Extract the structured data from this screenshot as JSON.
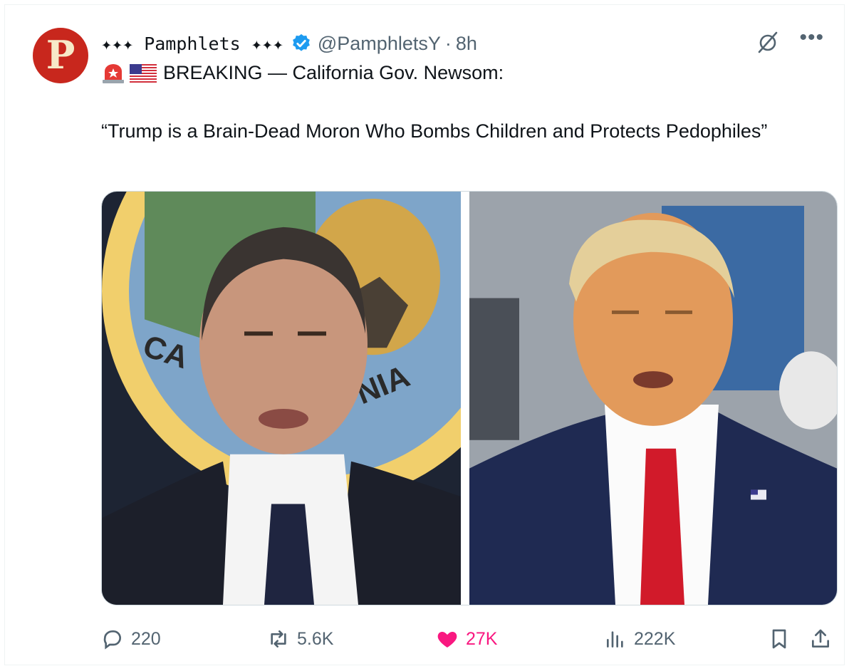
{
  "author": {
    "avatar_letter": "P",
    "display_name": "✦✦✦ Pamphlets ✦✦✦",
    "handle": "@PamphletsY",
    "separator": "·",
    "time": "8h"
  },
  "tweet": {
    "emoji_siren": "🚨",
    "emoji_flag": "🇺🇸",
    "headline": "BREAKING — California Gov. Newsom:",
    "quote": "“Trump is a Brain-Dead Moron Who Bombs Children and Protects Pedophiles”"
  },
  "media": {
    "left_seal_text_1": "CA",
    "left_seal_text_2": "NIA"
  },
  "actions": {
    "replies": "220",
    "reposts": "5.6K",
    "likes": "27K",
    "views": "222K"
  },
  "colors": {
    "avatar_bg": "#c8271d",
    "verified": "#1d9bf0",
    "like": "#f91880",
    "secondary_text": "#536471"
  },
  "icons": [
    "verified-badge-icon",
    "grok-icon",
    "more-icon",
    "siren-icon",
    "us-flag-icon",
    "reply-icon",
    "repost-icon",
    "like-icon",
    "views-icon",
    "bookmark-icon",
    "share-icon"
  ]
}
